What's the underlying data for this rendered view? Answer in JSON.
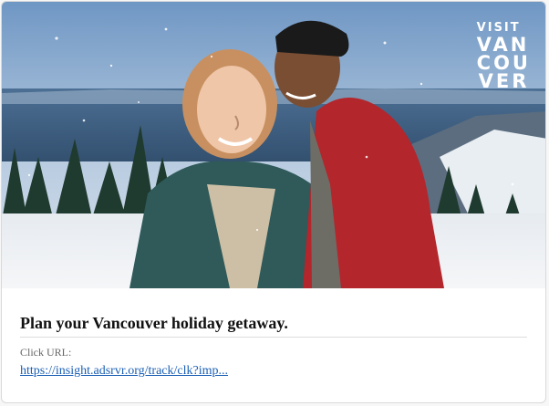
{
  "brand": {
    "logo_lines": [
      "VISIT",
      "VAN",
      "COU",
      "VER"
    ]
  },
  "ad": {
    "headline": "Plan your Vancouver holiday getaway.",
    "click_label": "Click URL:",
    "click_url": "https://insight.adsrvr.org/track/clk?imp..."
  },
  "colors": {
    "link": "#1a5fb4",
    "headline": "#111111",
    "sky_top": "#7fa6cf",
    "jacket_red": "#b3262c",
    "coat_green": "#2f5a59"
  }
}
